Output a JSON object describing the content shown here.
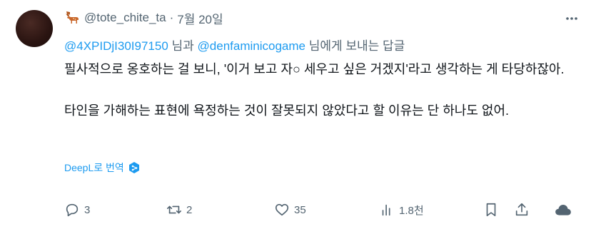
{
  "tweet": {
    "handle": "@tote_chite_ta",
    "separator": "·",
    "date": "7월 20일",
    "replying_to": {
      "user1": "@4XPIDjI30I97150",
      "conj": " 님과 ",
      "user2": "@denfaminicogame",
      "suffix": " 님에게 보내는 답글"
    },
    "paragraphs": [
      "필사적으로 옹호하는 걸 보니, '이거 보고 자○ 세우고 싶은 거겠지'라고 생각하는 게 타당하잖아.",
      "타인을 가해하는 표현에 욕정하는 것이 잘못되지 않았다고 할 이유는 단 하나도 없어."
    ],
    "translate_label": "DeepL로 번역",
    "actions": {
      "replies": "3",
      "retweets": "2",
      "likes": "35",
      "views": "1.8천"
    },
    "accent_color": "#1d9bf0",
    "muted_color": "#536471"
  }
}
